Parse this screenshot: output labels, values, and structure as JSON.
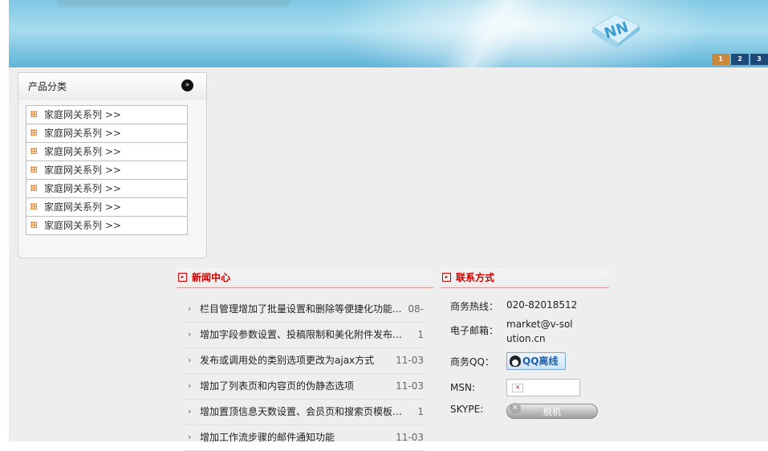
{
  "banner": {
    "pager": [
      "1",
      "2",
      "3"
    ],
    "active_page": "1"
  },
  "category": {
    "title": "产品分类",
    "more_icon": "»",
    "items": [
      "家庭网关系列 >>",
      "家庭网关系列 >>",
      "家庭网关系列 >>",
      "家庭网关系列 >>",
      "家庭网关系列 >>",
      "家庭网关系列 >>",
      "家庭网关系列 >>"
    ]
  },
  "news": {
    "title": "新闻中心",
    "items": [
      {
        "title": "栏目管理增加了批量设置和删除等便捷化功能...",
        "date": "08-"
      },
      {
        "title": "增加字段参数设置、投稿限制和美化附件发布界面",
        "date": "1"
      },
      {
        "title": "发布或调用处的类别选项更改为ajax方式",
        "date": "11-03"
      },
      {
        "title": "增加了列表页和内容页的伪静态选项",
        "date": "11-03"
      },
      {
        "title": "增加置顶信息天数设置、会员页和搜索页模板自定",
        "date": "1"
      },
      {
        "title": "增加工作流步骤的邮件通知功能",
        "date": "11-03"
      }
    ]
  },
  "contact": {
    "title": "联系方式",
    "hotline_label": "商务热线：",
    "hotline_value": "020-82018512",
    "email_label": "电子邮箱：",
    "email_value": "market@v-solution.cn",
    "qq_label": "商务QQ：",
    "qq_button": "QQ离线",
    "msn_label": "MSN:",
    "skype_label": "SKYPE:",
    "skype_button": "脱机"
  },
  "colors": {
    "accent_red": "#cc0000",
    "pager_active": "#c98a3e",
    "pager_inactive": "#1e4a7a"
  }
}
